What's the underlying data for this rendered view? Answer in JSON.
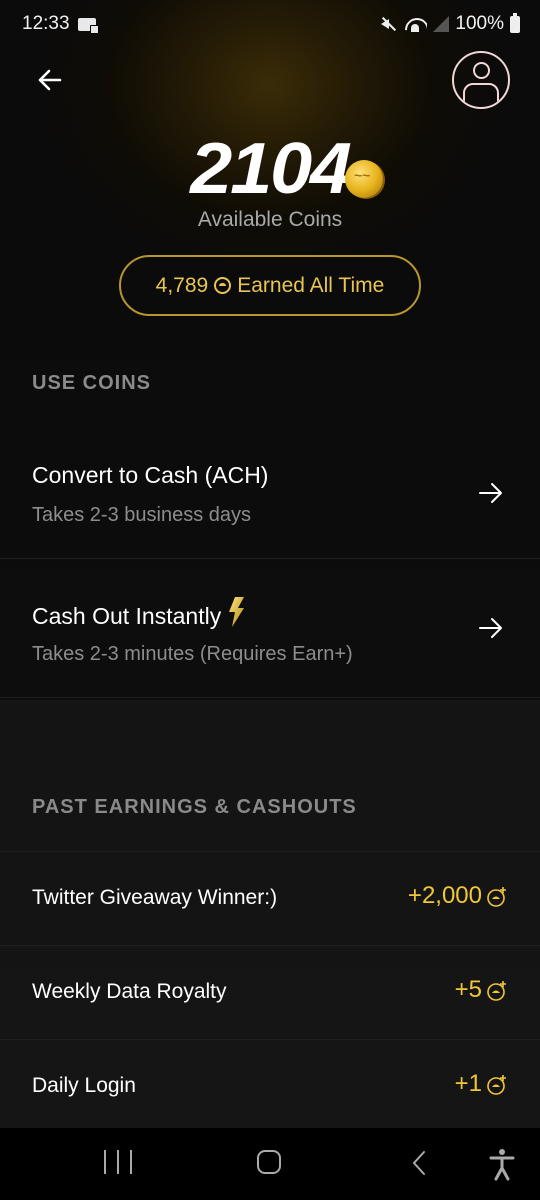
{
  "status_bar": {
    "time": "12:33",
    "battery": "100%",
    "icons": [
      "voicemail-icon",
      "mute-icon",
      "wifi-icon",
      "signal-icon",
      "battery-icon"
    ]
  },
  "header": {
    "back_icon": "arrow-left-icon",
    "profile_icon": "user-circle-icon"
  },
  "balance": {
    "available_coins": "2104",
    "available_label": "Available Coins",
    "earned_all_time_value": "4,789",
    "earned_all_time_label": "Earned All Time"
  },
  "use_coins": {
    "title": "USE COINS",
    "options": [
      {
        "title": "Convert to Cash (ACH)",
        "subtitle": "Takes 2-3 business days",
        "icon": "arrow-right-icon"
      },
      {
        "title": "Cash Out Instantly",
        "subtitle": "Takes 2-3 minutes (Requires Earn+)",
        "icon": "arrow-right-icon",
        "badge_icon": "lightning-bolt-icon"
      }
    ]
  },
  "history": {
    "title": "PAST EARNINGS & CASHOUTS",
    "items": [
      {
        "label": "Twitter Giveaway Winner:)",
        "amount": "+2,000"
      },
      {
        "label": "Weekly Data Royalty",
        "amount": "+5"
      },
      {
        "label": "Daily Login",
        "amount": "+1"
      }
    ]
  },
  "nav_bar": {
    "buttons": [
      "recent-apps",
      "home",
      "back",
      "accessibility"
    ]
  },
  "colors": {
    "accent_gold": "#f0c638",
    "pill_border": "#b7952f",
    "section_title": "#8a8a8a",
    "subtitle": "#8d8d8d"
  }
}
